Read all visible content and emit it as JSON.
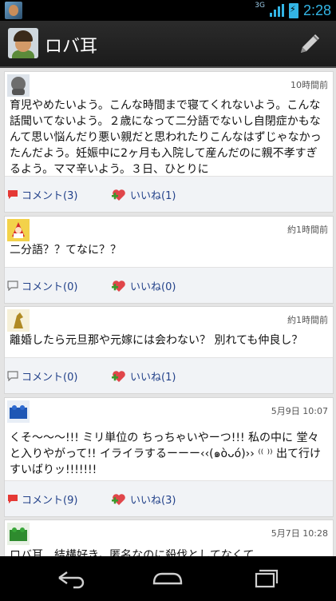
{
  "status": {
    "network": "3G",
    "clock": "2:28"
  },
  "app": {
    "title": "ロバ耳"
  },
  "posts": [
    {
      "time": "10時間前",
      "text": "育児やめたいよう。こんな時間まで寝てくれないよう。こんな話聞いてないよう。２歳になって二分語でないし自閉症かもなんて思い悩んだり悪い親だと思われたりこんなはずじゃなかったんだよう。妊娠中に2ヶ月も入院して産んだのに親不孝すぎるよう。ママ辛いよう。３日、ひとりに",
      "comment_label": "コメント(3)",
      "like_label": "いいね(1)"
    },
    {
      "time": "約1時間前",
      "text": "二分語？？てなに？？",
      "comment_label": "コメント(0)",
      "like_label": "いいね(0)"
    },
    {
      "time": "約1時間前",
      "text": "離婚したら元旦那や元嫁には会わない？ 別れても仲良し？",
      "comment_label": "コメント(0)",
      "like_label": "いいね(1)"
    },
    {
      "time": "5月9日 10:07",
      "text": "くそ〜〜〜!!! ミリ単位の ちっちゃいやーつ!!! 私の中に 堂々と入りやがって!! イライラするーーー‹‹(๑òᴗó)›› ⁽⁽ ⁾⁾ 出て行けすいばりッ!!!!!!!",
      "comment_label": "コメント(9)",
      "like_label": "いいね(3)"
    },
    {
      "time": "5月7日 10:28",
      "text": "ロバ耳、結構好き。匿名なのに殺伐としてなくて",
      "comment_label": "",
      "like_label": ""
    }
  ]
}
